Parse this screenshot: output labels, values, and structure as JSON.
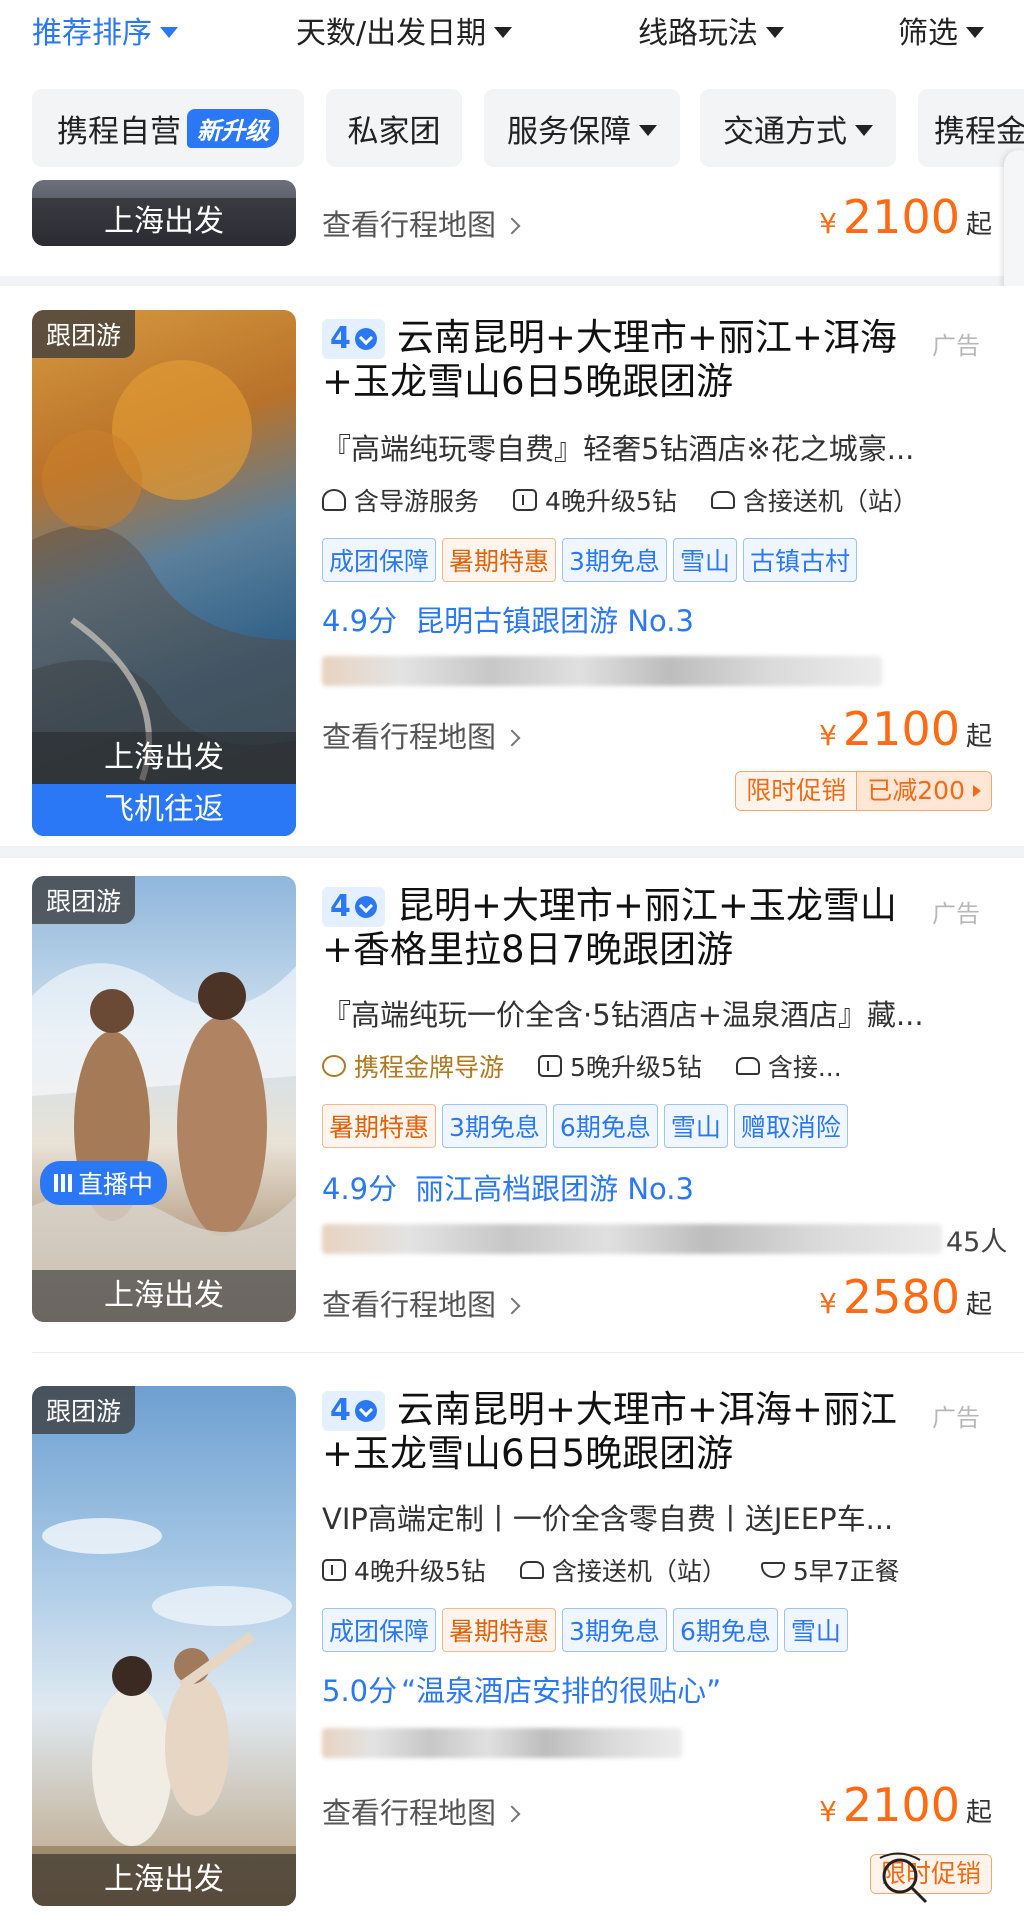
{
  "sort_bar": {
    "items": [
      {
        "label": "推荐排序",
        "active": true
      },
      {
        "label": "天数/出发日期",
        "active": false
      },
      {
        "label": "线路玩法",
        "active": false
      },
      {
        "label": "筛选",
        "active": false
      }
    ]
  },
  "filter_chips": {
    "self_op": "携程自营",
    "new_badge": "新升级",
    "private": "私家团",
    "service": "服务保障",
    "transport": "交通方式",
    "gold": "携程金"
  },
  "partial_card": {
    "depart": "上海出发",
    "map_link": "查看行程地图",
    "price": {
      "currency": "¥",
      "amount": "2100",
      "suffix": "起"
    }
  },
  "cards": [
    {
      "thumb_tag": "跟团游",
      "level": "4",
      "title": "云南昆明+大理市+丽江+洱海+玉龙雪山6日5晚跟团游",
      "ad": "广告",
      "subtitle": "『高端纯玩零自费』轻奢5钻酒店※花之城豪...",
      "features": [
        "含导游服务",
        "4晚升级5钻",
        "含接送机（站）"
      ],
      "tags": [
        {
          "text": "成团保障",
          "color": "blue"
        },
        {
          "text": "暑期特惠",
          "color": "orange"
        },
        {
          "text": "3期免息",
          "color": "blue"
        },
        {
          "text": "雪山",
          "color": "blue"
        },
        {
          "text": "古镇古村",
          "color": "blue"
        }
      ],
      "score": "4.9分",
      "rank": "昆明古镇跟团游 No.3",
      "depart": "上海出发",
      "transport_bar": "飞机往返",
      "map_link": "查看行程地图",
      "price": {
        "currency": "¥",
        "amount": "2100",
        "suffix": "起"
      },
      "promo": {
        "label": "限时促销",
        "value": "已减200"
      }
    },
    {
      "thumb_tag": "跟团游",
      "level": "4",
      "title": "昆明+大理市+丽江+玉龙雪山+香格里拉8日7晚跟团游",
      "ad": "广告",
      "subtitle": "『高端纯玩一价全含·5钻酒店+温泉酒店』藏...",
      "features": [
        "携程金牌导游",
        "5晚升级5钻",
        "含接..."
      ],
      "tags": [
        {
          "text": "暑期特惠",
          "color": "orange"
        },
        {
          "text": "3期免息",
          "color": "blue"
        },
        {
          "text": "6期免息",
          "color": "blue"
        },
        {
          "text": "雪山",
          "color": "blue"
        },
        {
          "text": "赠取消险",
          "color": "blue"
        }
      ],
      "score": "4.9分",
      "rank": "丽江高档跟团游 No.3",
      "live": "直播中",
      "blur_tail": "45人",
      "depart": "上海出发",
      "map_link": "查看行程地图",
      "price": {
        "currency": "¥",
        "amount": "2580",
        "suffix": "起"
      }
    },
    {
      "thumb_tag": "跟团游",
      "level": "4",
      "title": "云南昆明+大理市+洱海+丽江+玉龙雪山6日5晚跟团游",
      "ad": "广告",
      "subtitle": "VIP高端定制丨一价全含零自费丨送JEEP车...",
      "features": [
        "4晚升级5钻",
        "含接送机（站）",
        "5早7正餐"
      ],
      "tags": [
        {
          "text": "成团保障",
          "color": "blue"
        },
        {
          "text": "暑期特惠",
          "color": "orange"
        },
        {
          "text": "3期免息",
          "color": "blue"
        },
        {
          "text": "6期免息",
          "color": "blue"
        },
        {
          "text": "雪山",
          "color": "blue"
        }
      ],
      "score": "5.0分",
      "quote": "“温泉酒店安排的很贴心”",
      "depart": "上海出发",
      "map_link": "查看行程地图",
      "price": {
        "currency": "¥",
        "amount": "2100",
        "suffix": "起"
      },
      "promo": {
        "label": "限时促销"
      }
    }
  ],
  "colors": {
    "accent": "#2a78f5",
    "price": "#ff6a13",
    "tag_orange": "#e0620a"
  },
  "icons": [
    "caret-down-icon",
    "guide-icon",
    "hotel-icon",
    "car-icon",
    "medal-icon",
    "meal-icon",
    "chevron-right-icon",
    "live-icon",
    "verified-icon",
    "zoom-icon"
  ]
}
